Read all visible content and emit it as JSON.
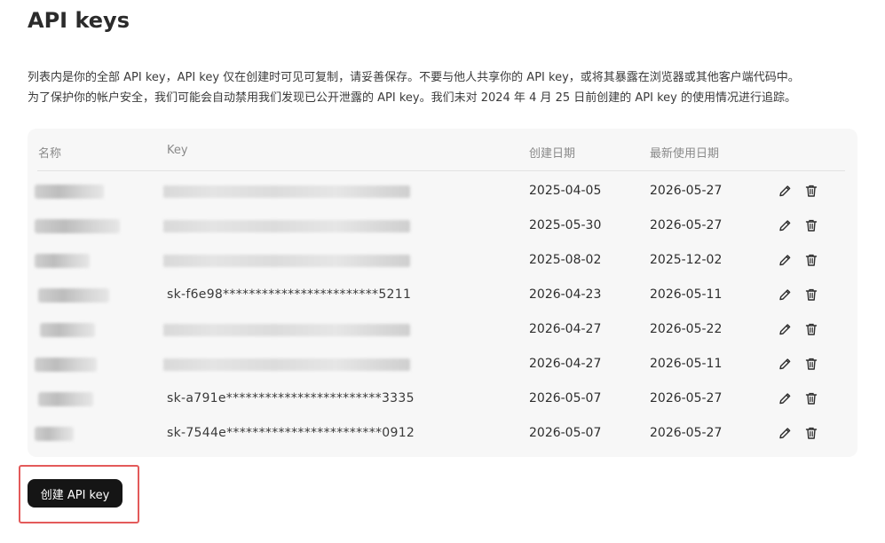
{
  "page": {
    "title": "API keys",
    "description_line1": "列表内是你的全部 API key，API key 仅在创建时可见可复制，请妥善保存。不要与他人共享你的 API key，或将其暴露在浏览器或其他客户端代码中。",
    "description_line2": "为了保护你的帐户安全，我们可能会自动禁用我们发现已公开泄露的 API key。我们未对 2024 年 4 月 25 日前创建的 API key 的使用情况进行追踪。"
  },
  "table": {
    "headers": {
      "name": "名称",
      "key": "Key",
      "created": "创建日期",
      "last_used": "最新使用日期"
    },
    "rows": [
      {
        "name": "",
        "key": "",
        "created": "2025-04-05",
        "last_used": "2026-05-27",
        "name_redacted": true,
        "key_redacted": true
      },
      {
        "name": "",
        "key": "",
        "created": "2025-05-30",
        "last_used": "2026-05-27",
        "name_redacted": true,
        "key_redacted": true
      },
      {
        "name": "",
        "key": "",
        "created": "2025-08-02",
        "last_used": "2025-12-02",
        "name_redacted": true,
        "key_redacted": true
      },
      {
        "name": "",
        "key": "sk-f6e98************************5211",
        "created": "2026-04-23",
        "last_used": "2026-05-11",
        "name_redacted": true,
        "key_redacted": false
      },
      {
        "name": "",
        "key": "",
        "created": "2026-04-27",
        "last_used": "2026-05-22",
        "name_redacted": true,
        "key_redacted": true
      },
      {
        "name": "",
        "key": "",
        "created": "2026-04-27",
        "last_used": "2026-05-11",
        "name_redacted": true,
        "key_redacted": true
      },
      {
        "name": "",
        "key": "sk-a791e************************3335",
        "created": "2026-05-07",
        "last_used": "2026-05-27",
        "name_redacted": true,
        "key_redacted": false
      },
      {
        "name": "",
        "key": "sk-7544e************************0912",
        "created": "2026-05-07",
        "last_used": "2026-05-27",
        "name_redacted": true,
        "key_redacted": false
      }
    ],
    "row_icons": [
      "pencil-icon",
      "trash-icon"
    ]
  },
  "actions": {
    "create_label": "创建 API key"
  },
  "colors": {
    "primary_button": "#151515",
    "highlight_border": "#e35a5a",
    "table_bg": "#f7f7f7"
  }
}
